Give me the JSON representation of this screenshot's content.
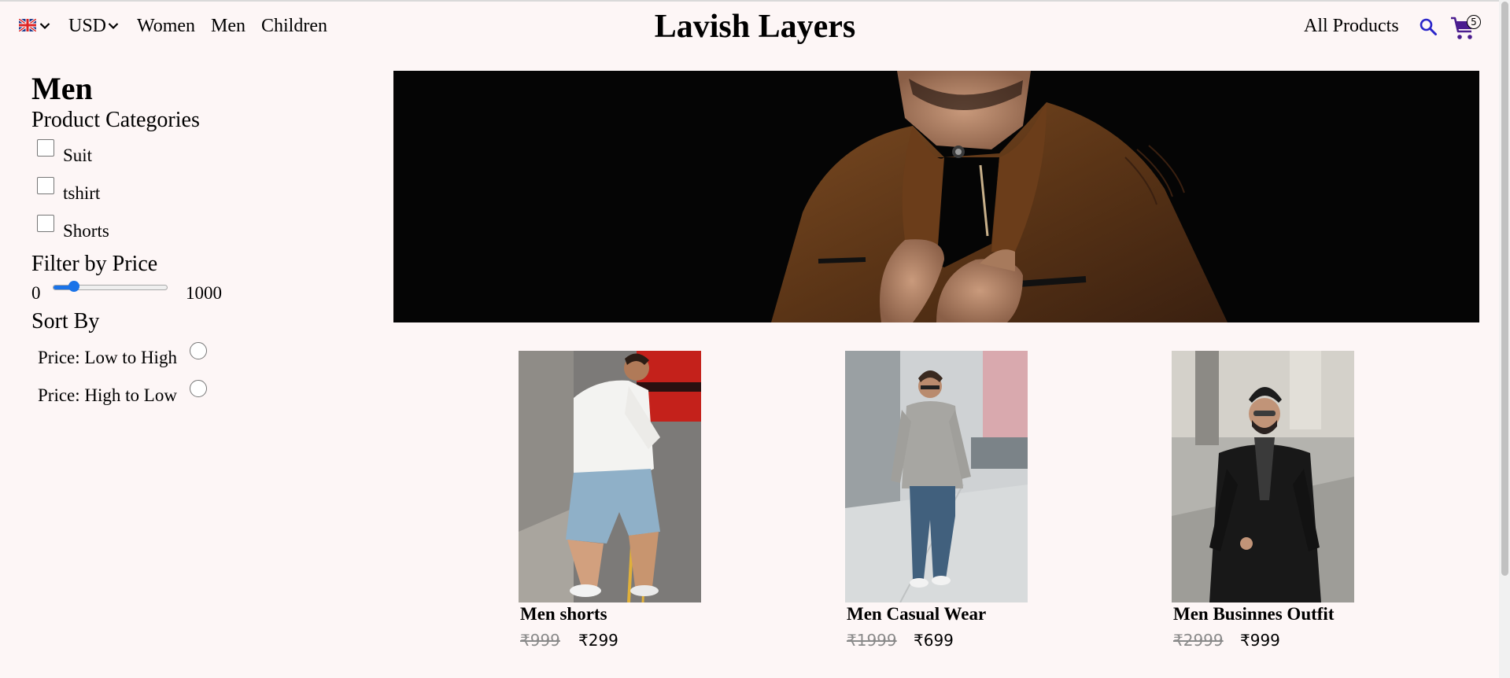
{
  "header": {
    "language_icon": "uk-flag-icon",
    "currency": "USD",
    "nav": [
      "Women",
      "Men",
      "Children"
    ],
    "brand": "Lavish Layers",
    "all_products": "All Products",
    "cart_count": "5",
    "accent_color": "#4b1d8f"
  },
  "sidebar": {
    "title": "Men",
    "categories_heading": "Product Categories",
    "categories": [
      "Suit",
      "tshirt",
      "Shorts"
    ],
    "price_heading": "Filter by Price",
    "price_min": "0",
    "price_max": "1000",
    "price_slider_fraction": 0.18,
    "sort_heading": "Sort By",
    "sort_options": [
      "Price: Low to High",
      "Price: High to Low"
    ]
  },
  "products": [
    {
      "name": "Men shorts",
      "old_price": "₹999",
      "price": "₹299"
    },
    {
      "name": "Men Casual Wear",
      "old_price": "₹1999",
      "price": "₹699"
    },
    {
      "name": "Men Businnes Outfit",
      "old_price": "₹2999",
      "price": "₹999"
    }
  ]
}
